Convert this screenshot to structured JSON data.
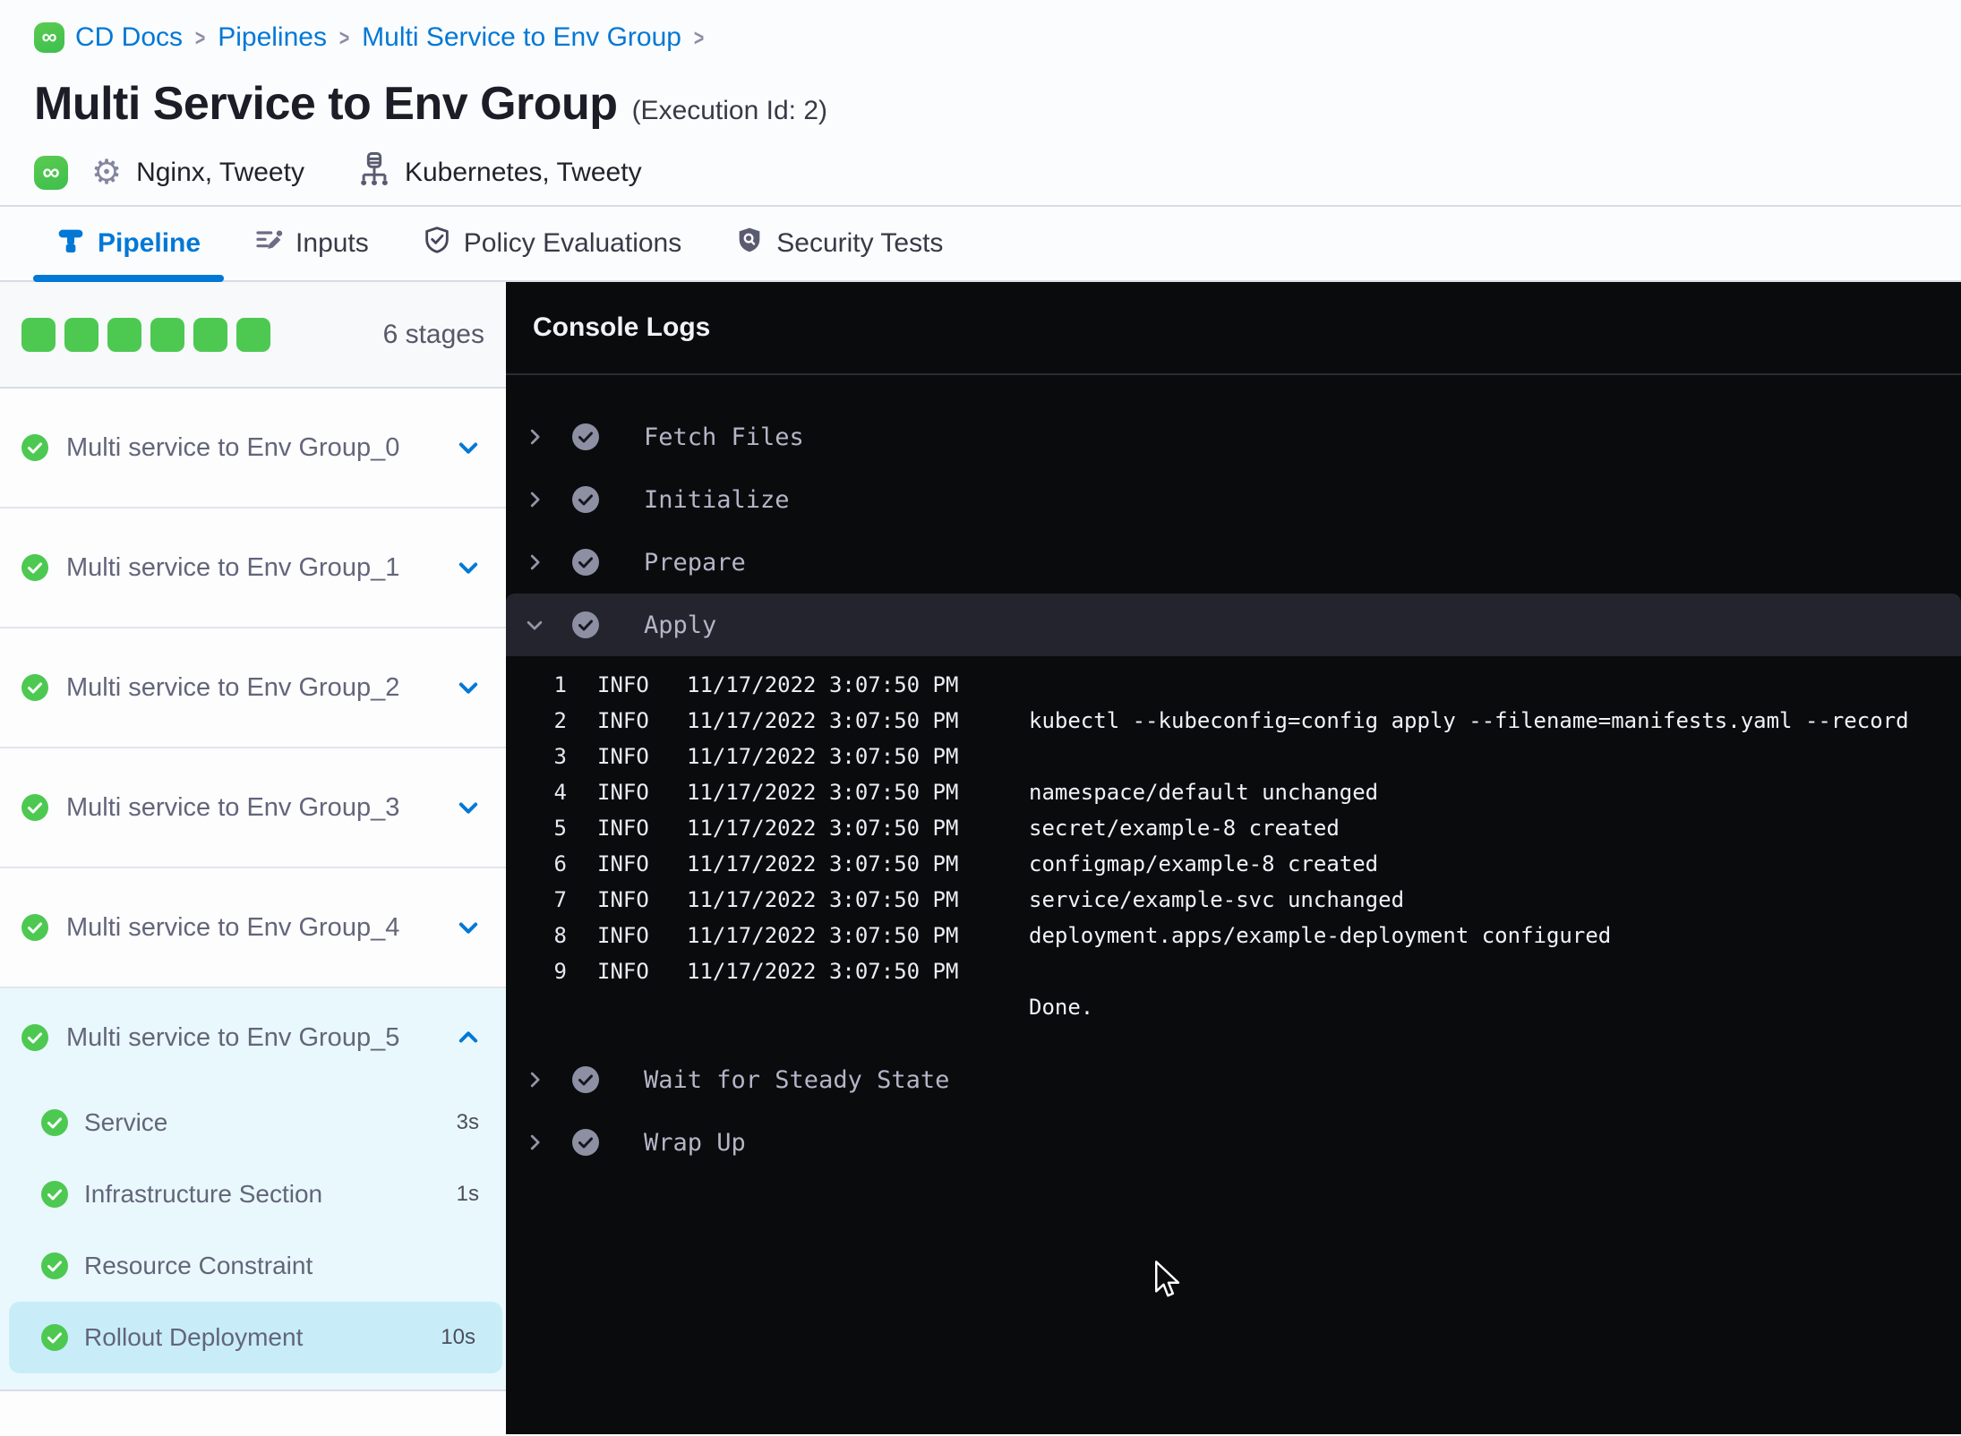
{
  "colors": {
    "accent_blue": "#0278d5",
    "success_green": "#4dc952",
    "console_bg": "#0a0b0d"
  },
  "icons": {
    "infinity_glyph": "∞",
    "gear_glyph": "⚙"
  },
  "breadcrumb": {
    "items": [
      {
        "label": "CD Docs"
      },
      {
        "label": "Pipelines"
      },
      {
        "label": "Multi Service to Env Group"
      }
    ],
    "separator": ">"
  },
  "header": {
    "title": "Multi Service to Env Group",
    "execution_id": "(Execution Id: 2)",
    "services_label": "Nginx, Tweety",
    "environments_label": "Kubernetes, Tweety"
  },
  "tabs": [
    {
      "label": "Pipeline"
    },
    {
      "label": "Inputs"
    },
    {
      "label": "Policy Evaluations"
    },
    {
      "label": "Security Tests"
    }
  ],
  "sidebar": {
    "stages_count": "6 stages",
    "stages": [
      {
        "name": "Multi service to Env Group_0"
      },
      {
        "name": "Multi service to Env Group_1"
      },
      {
        "name": "Multi service to Env Group_2"
      },
      {
        "name": "Multi service to Env Group_3"
      },
      {
        "name": "Multi service to Env Group_4"
      },
      {
        "name": "Multi service to Env Group_5",
        "steps": [
          {
            "name": "Service",
            "duration": "3s"
          },
          {
            "name": "Infrastructure Section",
            "duration": "1s"
          },
          {
            "name": "Resource Constraint",
            "duration": ""
          },
          {
            "name": "Rollout Deployment",
            "duration": "10s"
          }
        ]
      }
    ]
  },
  "console": {
    "title": "Console Logs",
    "steps": [
      {
        "name": "Fetch Files"
      },
      {
        "name": "Initialize"
      },
      {
        "name": "Prepare"
      },
      {
        "name": "Apply"
      },
      {
        "name": "Wait for Steady State"
      },
      {
        "name": "Wrap Up"
      }
    ],
    "logs": [
      {
        "n": "1",
        "level": "INFO",
        "time": "11/17/2022 3:07:50 PM",
        "msg": ""
      },
      {
        "n": "2",
        "level": "INFO",
        "time": "11/17/2022 3:07:50 PM",
        "msg": "kubectl --kubeconfig=config apply --filename=manifests.yaml --record"
      },
      {
        "n": "3",
        "level": "INFO",
        "time": "11/17/2022 3:07:50 PM",
        "msg": ""
      },
      {
        "n": "4",
        "level": "INFO",
        "time": "11/17/2022 3:07:50 PM",
        "msg": "namespace/default unchanged"
      },
      {
        "n": "5",
        "level": "INFO",
        "time": "11/17/2022 3:07:50 PM",
        "msg": "secret/example-8 created"
      },
      {
        "n": "6",
        "level": "INFO",
        "time": "11/17/2022 3:07:50 PM",
        "msg": "configmap/example-8 created"
      },
      {
        "n": "7",
        "level": "INFO",
        "time": "11/17/2022 3:07:50 PM",
        "msg": "service/example-svc unchanged"
      },
      {
        "n": "8",
        "level": "INFO",
        "time": "11/17/2022 3:07:50 PM",
        "msg": "deployment.apps/example-deployment configured"
      },
      {
        "n": "9",
        "level": "INFO",
        "time": "11/17/2022 3:07:50 PM",
        "msg": ""
      },
      {
        "n": "",
        "level": "",
        "time": "",
        "msg": "Done."
      }
    ]
  }
}
